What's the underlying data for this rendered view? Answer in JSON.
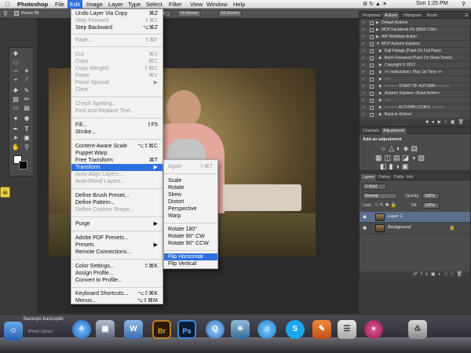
{
  "menubar": {
    "app_name": "Photoshop",
    "items": [
      "File",
      "Edit",
      "Image",
      "Layer",
      "Type",
      "Select",
      "Filter",
      "View",
      "Window",
      "Help"
    ],
    "active": "Edit",
    "clock": "Sun 1:25 PM"
  },
  "options_bar": {
    "resize_label": "Resize Wi",
    "buttons": [
      "100%",
      "Fit Screen",
      "Fill Screen"
    ]
  },
  "edit_menu": {
    "items": [
      {
        "label": "Undo Layer Via Copy",
        "shortcut": "⌘Z",
        "enabled": true
      },
      {
        "label": "Step Forward",
        "shortcut": "⇧⌘Z",
        "enabled": false
      },
      {
        "label": "Step Backward",
        "shortcut": "⌥⌘Z",
        "enabled": true
      },
      {
        "label": "Fade...",
        "shortcut": "⇧⌘F",
        "enabled": false
      },
      {
        "label": "Cut",
        "shortcut": "⌘X",
        "enabled": false
      },
      {
        "label": "Copy",
        "shortcut": "⌘C",
        "enabled": false
      },
      {
        "label": "Copy Merged",
        "shortcut": "⇧⌘C",
        "enabled": false
      },
      {
        "label": "Paste",
        "shortcut": "⌘V",
        "enabled": false
      },
      {
        "label": "Paste Special",
        "shortcut": "▶",
        "enabled": false
      },
      {
        "label": "Clear",
        "shortcut": "",
        "enabled": false
      },
      {
        "label": "Check Spelling...",
        "shortcut": "",
        "enabled": false
      },
      {
        "label": "Find and Replace Text...",
        "shortcut": "",
        "enabled": false
      },
      {
        "label": "Fill...",
        "shortcut": "⇧F5",
        "enabled": true
      },
      {
        "label": "Stroke...",
        "shortcut": "",
        "enabled": true
      },
      {
        "label": "Content-Aware Scale",
        "shortcut": "⌥⇧⌘C",
        "enabled": true
      },
      {
        "label": "Puppet Warp",
        "shortcut": "",
        "enabled": true
      },
      {
        "label": "Free Transform",
        "shortcut": "⌘T",
        "enabled": true
      },
      {
        "label": "Transform",
        "shortcut": "▶",
        "enabled": true
      },
      {
        "label": "Auto-Align Layers...",
        "shortcut": "",
        "enabled": false
      },
      {
        "label": "Auto-Blend Layers...",
        "shortcut": "",
        "enabled": false
      },
      {
        "label": "Define Brush Preset...",
        "shortcut": "",
        "enabled": true
      },
      {
        "label": "Define Pattern...",
        "shortcut": "",
        "enabled": true
      },
      {
        "label": "Define Custom Shape...",
        "shortcut": "",
        "enabled": false
      },
      {
        "label": "Purge",
        "shortcut": "▶",
        "enabled": true
      },
      {
        "label": "Adobe PDF Presets...",
        "shortcut": "",
        "enabled": true
      },
      {
        "label": "Presets",
        "shortcut": "▶",
        "enabled": true
      },
      {
        "label": "Remote Connections...",
        "shortcut": "",
        "enabled": true
      },
      {
        "label": "Color Settings...",
        "shortcut": "⇧⌘K",
        "enabled": true
      },
      {
        "label": "Assign Profile...",
        "shortcut": "",
        "enabled": true
      },
      {
        "label": "Convert to Profile...",
        "shortcut": "",
        "enabled": true
      },
      {
        "label": "Keyboard Shortcuts...",
        "shortcut": "⌥⇧⌘K",
        "enabled": true
      },
      {
        "label": "Menus...",
        "shortcut": "⌥⇧⌘M",
        "enabled": true
      }
    ]
  },
  "transform_submenu": {
    "items": [
      {
        "label": "Again",
        "shortcut": "⇧⌘T",
        "enabled": false
      },
      {
        "label": "Scale",
        "shortcut": "",
        "enabled": true
      },
      {
        "label": "Rotate",
        "shortcut": "",
        "enabled": true
      },
      {
        "label": "Skew",
        "shortcut": "",
        "enabled": true
      },
      {
        "label": "Distort",
        "shortcut": "",
        "enabled": true
      },
      {
        "label": "Perspective",
        "shortcut": "",
        "enabled": true
      },
      {
        "label": "Warp",
        "shortcut": "",
        "enabled": true
      },
      {
        "label": "Rotate 180°",
        "shortcut": "",
        "enabled": true
      },
      {
        "label": "Rotate 90° CW",
        "shortcut": "",
        "enabled": true
      },
      {
        "label": "Rotate 90° CCW",
        "shortcut": "",
        "enabled": true
      },
      {
        "label": "Flip Horizontal",
        "shortcut": "",
        "enabled": true
      },
      {
        "label": "Flip Vertical",
        "shortcut": "",
        "enabled": true
      }
    ],
    "highlighted": "Flip Horizontal"
  },
  "actions_panel": {
    "tabs": [
      "Properties",
      "Actions",
      "Histogram",
      "Brush"
    ],
    "active_tab": "Actions",
    "rows": [
      "Default Actions",
      "MCP Facebook Fix (BIG5 CS6+",
      "AIP Workflow Action",
      "MCP Autumn Equinox",
      "Fall Foliage (Paint On Full Pass)",
      "Burnt Firewood (Paint On Deep Tones)",
      "Copyright © 2012",
      "<< Instructions: Play 1st Time >>",
      "-----",
      "---------- START OF AUTUMN ----------",
      "Autumn Equinox <Base Action>",
      "-----",
      "---------- AUTUMN LOOKS ----------",
      "Back-to-School"
    ]
  },
  "adjustments_panel": {
    "tabs": [
      "Channels",
      "Adjustments"
    ],
    "active_tab": "Adjustments",
    "heading": "Add an adjustment"
  },
  "layers_panel": {
    "tabs": [
      "Layers",
      "History",
      "Paths",
      "Info"
    ],
    "active_tab": "Layers",
    "kind_label": "Kind",
    "blend_mode": "Normal",
    "opacity_label": "Opacity:",
    "opacity": "100%",
    "lock_label": "Lock:",
    "fill_label": "Fill:",
    "fill": "100%",
    "layers": [
      {
        "name": "Layer 1",
        "selected": true
      },
      {
        "name": "Background",
        "selected": false
      }
    ]
  },
  "dock": {
    "file_label": "Backups.backupdb",
    "file_sub": "iPhoto Library"
  },
  "colors": {
    "highlight": "#2f6fe0",
    "panel_bg": "#4b4b4b",
    "app_bg": "#3a3a3a"
  }
}
